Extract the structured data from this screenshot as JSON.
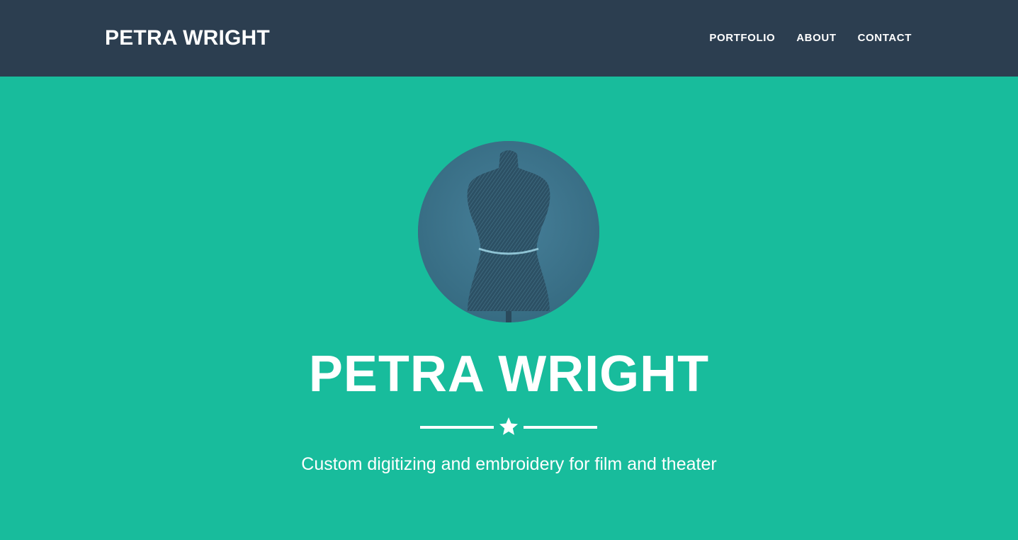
{
  "colors": {
    "navbar": "#2c3e50",
    "hero": "#18bc9c",
    "text": "#ffffff",
    "avatar": "#3f7589"
  },
  "navbar": {
    "brand": "PETRA WRIGHT",
    "links": [
      {
        "label": "PORTFOLIO"
      },
      {
        "label": "ABOUT"
      },
      {
        "label": "CONTACT"
      }
    ]
  },
  "hero": {
    "avatar_icon": "dress-form-photo",
    "title": "PETRA WRIGHT",
    "divider_icon": "star-icon",
    "tagline": "Custom digitizing and embroidery for film and theater"
  }
}
